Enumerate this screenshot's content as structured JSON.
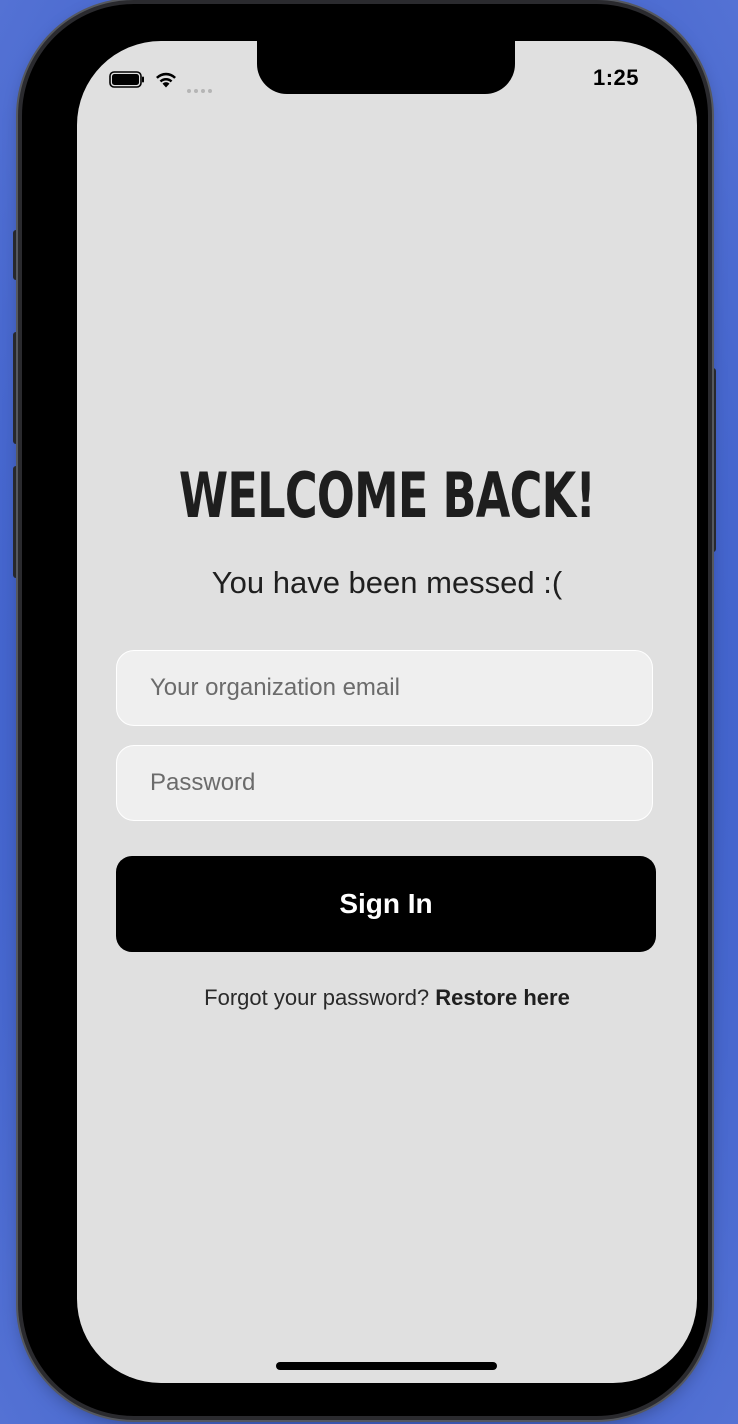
{
  "status_bar": {
    "time": "1:25",
    "icons": [
      "battery-icon",
      "wifi-icon",
      "signal-dots-icon"
    ]
  },
  "login": {
    "title": "WELCOME BACK!",
    "subtitle": "You have been messed :(",
    "email_placeholder": "Your organization email",
    "email_value": "",
    "password_placeholder": "Password",
    "password_value": "",
    "sign_in_label": "Sign In",
    "forgot_text": "Forgot your password?",
    "restore_link": "Restore here"
  },
  "colors": {
    "background": "#e0e0e0",
    "button": "#000000",
    "button_text": "#ffffff",
    "field_bg": "#efefef",
    "desktop_bg": "#4a6fd6"
  }
}
